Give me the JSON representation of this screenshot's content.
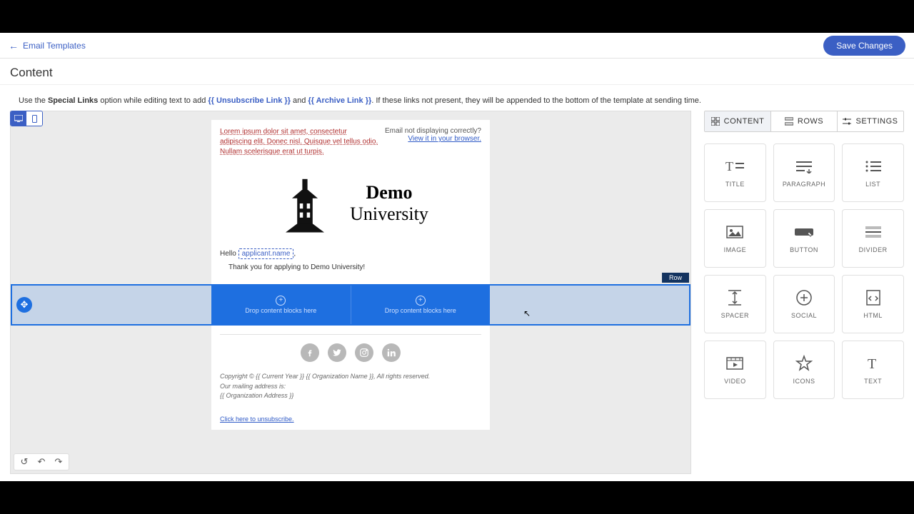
{
  "topbar": {
    "back_label": "Email Templates",
    "save_label": "Save Changes"
  },
  "header": {
    "title": "Content"
  },
  "hint": {
    "pre": "Use the ",
    "special": "Special Links",
    "mid1": " option while editing text to add ",
    "tag1": "{{ Unsubscribe Link }}",
    "mid2": " and ",
    "tag2": "{{ Archive Link }}",
    "post": ". If these links not present, they will be appended to the bottom of the template at sending time."
  },
  "viewport": {
    "desktop": "desktop",
    "mobile": "mobile"
  },
  "email": {
    "lorem": "Lorem ipsum dolor sit amet, consectetur adipiscing elit. Donec nisl. Quisque vel tellus odio. Nullam scelerisque erat ut turpis.",
    "view_q": "Email not displaying correctly?",
    "view_link": "View it in your browser.",
    "logo_line1": "Demo",
    "logo_line2": "University",
    "hello_pre": "Hello ",
    "hello_tag": "applicant.name",
    "hello_post": ",",
    "thanks": "Thank you for applying to Demo University!",
    "drop_text": "Drop content blocks here",
    "row_tag": "Row",
    "copyright": "Copyright © {{ Current Year }} {{ Organization Name }}, All rights reserved.",
    "mail_addr_label": "Our mailing address is:",
    "mail_addr_tag": "{{ Organization Address }}",
    "unsub": "Click here to unsubscribe."
  },
  "panel": {
    "tabs": {
      "content": "CONTENT",
      "rows": "ROWS",
      "settings": "SETTINGS"
    },
    "blocks": [
      {
        "key": "title",
        "label": "TITLE"
      },
      {
        "key": "paragraph",
        "label": "PARAGRAPH"
      },
      {
        "key": "list",
        "label": "LIST"
      },
      {
        "key": "image",
        "label": "IMAGE"
      },
      {
        "key": "button",
        "label": "BUTTON"
      },
      {
        "key": "divider",
        "label": "DIVIDER"
      },
      {
        "key": "spacer",
        "label": "SPACER"
      },
      {
        "key": "social",
        "label": "SOCIAL"
      },
      {
        "key": "html",
        "label": "HTML"
      },
      {
        "key": "video",
        "label": "VIDEO"
      },
      {
        "key": "icons",
        "label": "ICONS"
      },
      {
        "key": "text",
        "label": "TEXT"
      }
    ]
  }
}
